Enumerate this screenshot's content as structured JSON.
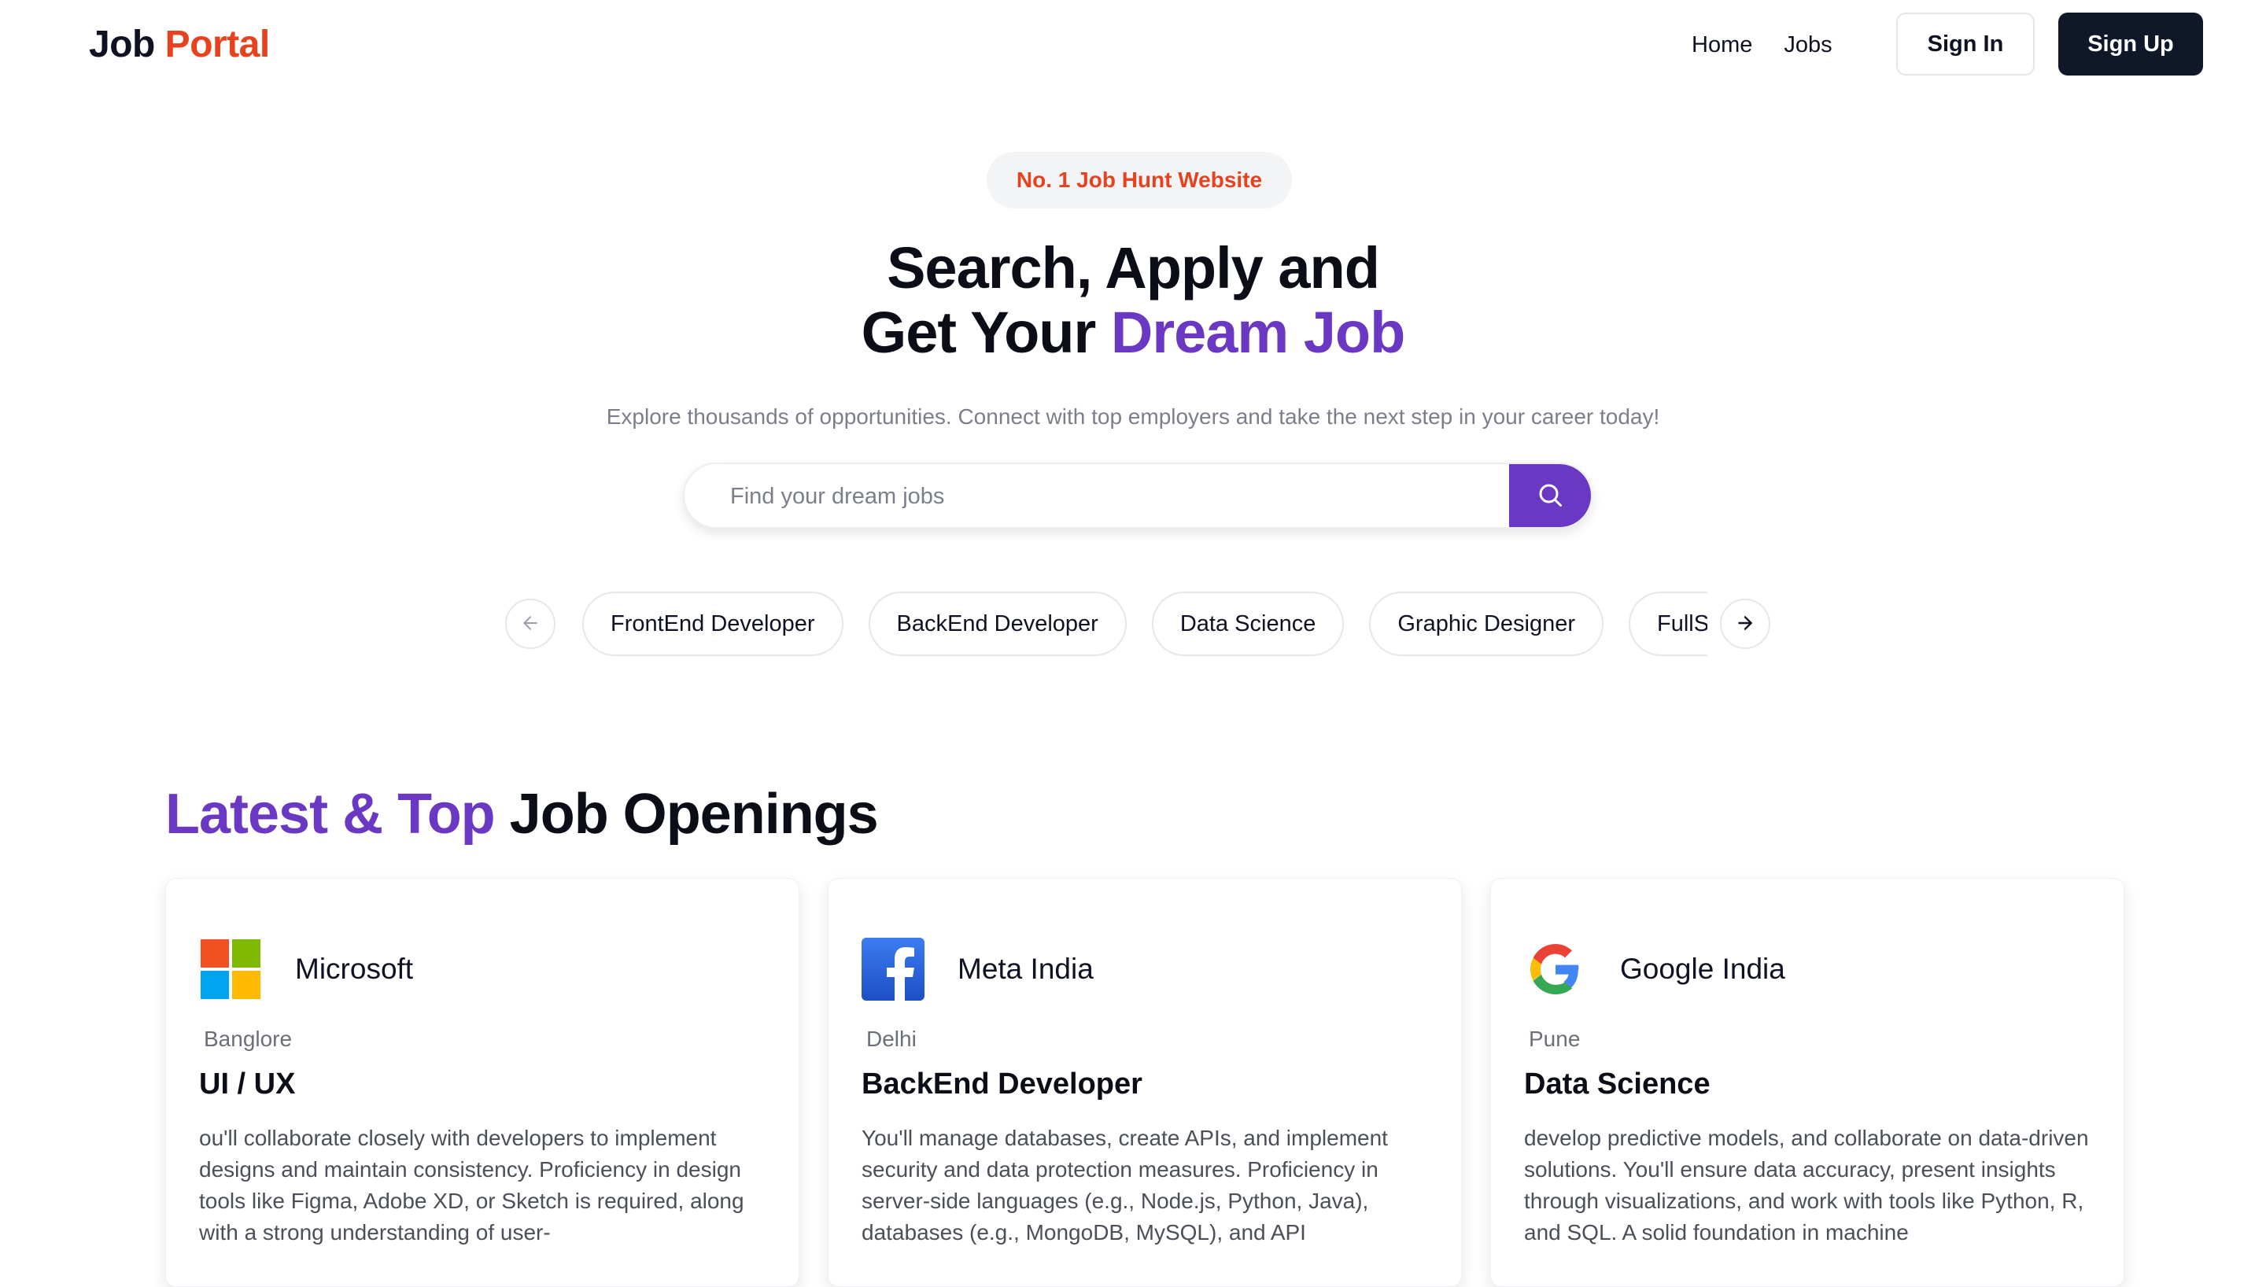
{
  "nav": {
    "logo_main": "Job ",
    "logo_accent": "Portal",
    "links": [
      "Home",
      "Jobs"
    ],
    "sign_in": "Sign In",
    "sign_up": "Sign Up"
  },
  "hero": {
    "badge": "No. 1 Job Hunt Website",
    "title_line1": "Search, Apply and",
    "title_line2_plain": "Get Your ",
    "title_line2_accent": "Dream Job",
    "subtitle": "Explore thousands of opportunities. Connect with top employers and take the next step in your career today!",
    "search_placeholder": "Find your dream jobs"
  },
  "categories": [
    "FrontEnd Developer",
    "BackEnd Developer",
    "Data Science",
    "Graphic Designer",
    "FullStack Developer"
  ],
  "latest": {
    "title_accent": "Latest & Top",
    "title_plain": " Job Openings",
    "jobs": [
      {
        "company": "Microsoft",
        "logo": "microsoft-logo",
        "location": "Banglore",
        "title": "UI / UX",
        "description": "ou'll collaborate closely with developers to implement designs and maintain consistency. Proficiency in design tools like Figma, Adobe XD, or Sketch is required, along with a strong understanding of user-"
      },
      {
        "company": "Meta India",
        "logo": "facebook-logo",
        "location": "Delhi",
        "title": "BackEnd Developer",
        "description": "You'll manage databases, create APIs, and implement security and data protection measures. Proficiency in server-side languages (e.g., Node.js, Python, Java), databases (e.g., MongoDB, MySQL), and API"
      },
      {
        "company": "Google India",
        "logo": "google-logo",
        "location": "Pune",
        "title": "Data Science",
        "description": "develop predictive models, and collaborate on data-driven solutions. You'll ensure data accuracy, present insights through visualizations, and work with tools like Python, R, and SQL. A solid foundation in machine"
      }
    ]
  },
  "colors": {
    "brand_orange": "#e8411d",
    "brand_purple": "#6a38c2",
    "dark_button": "#0f1729"
  }
}
